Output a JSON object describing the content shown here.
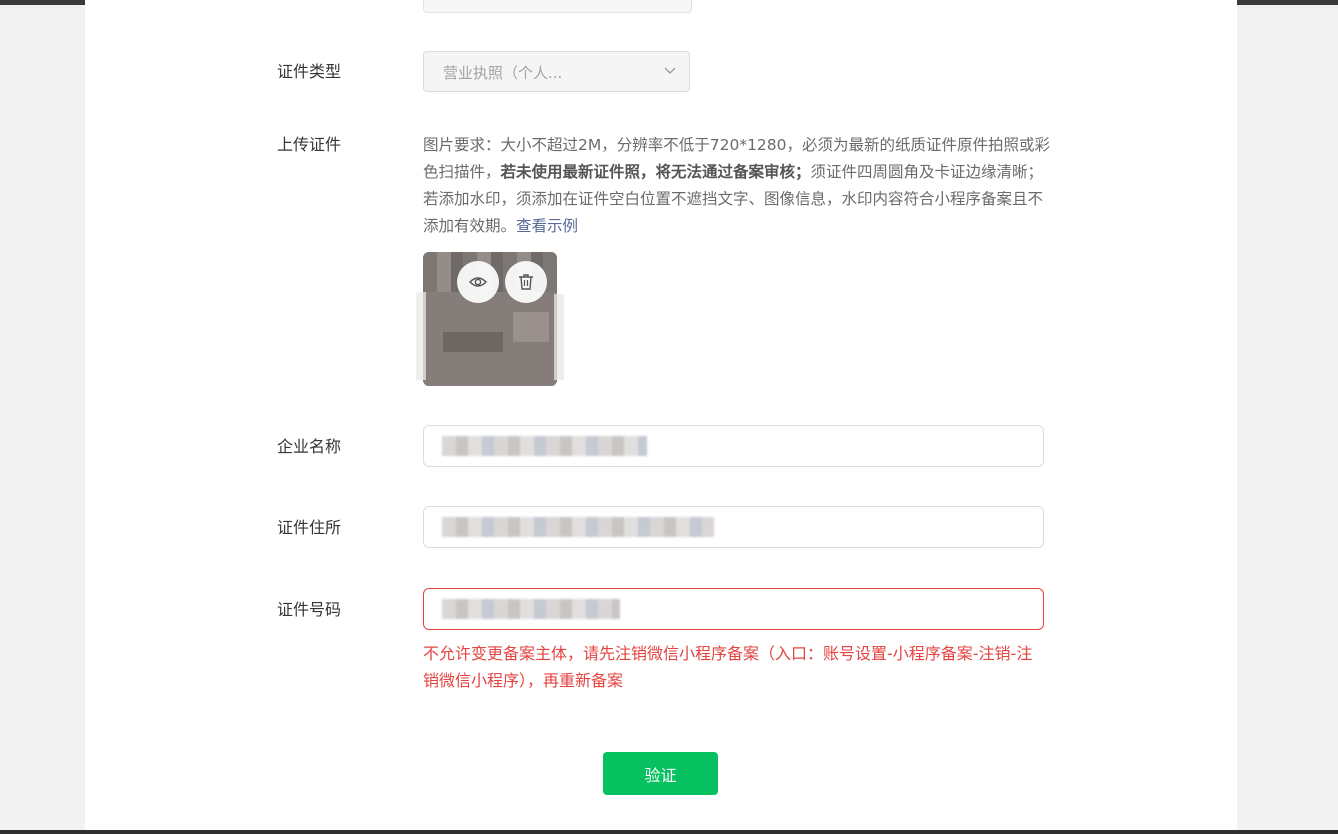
{
  "form": {
    "cert_type": {
      "label": "证件类型",
      "value": "营业执照（个人..."
    },
    "upload": {
      "label": "上传证件",
      "req_part1": "图片要求：大小不超过2M，分辨率不低于720*1280，必须为最新的纸质证件原件拍照或彩色扫描件，",
      "req_bold": "若未使用最新证件照，将无法通过备案审核；",
      "req_part2": "须证件四周圆角及卡证边缘清晰；若添加水印，须添加在证件空白位置不遮挡文字、图像信息，水印内容符合小程序备案且不添加有效期。",
      "example_link": "查看示例",
      "preview_icon": "eye-icon",
      "delete_icon": "trash-icon"
    },
    "company_name": {
      "label": "企业名称",
      "value": ""
    },
    "cert_address": {
      "label": "证件住所",
      "value": ""
    },
    "cert_number": {
      "label": "证件号码",
      "value": "",
      "error": "不允许变更备案主体，请先注销微信小程序备案（入口：账号设置-小程序备案-注销-注销微信小程序），再重新备案"
    },
    "submit_label": "验证"
  },
  "colors": {
    "primary": "#07c160",
    "error": "#e64340",
    "link": "#576b95"
  }
}
